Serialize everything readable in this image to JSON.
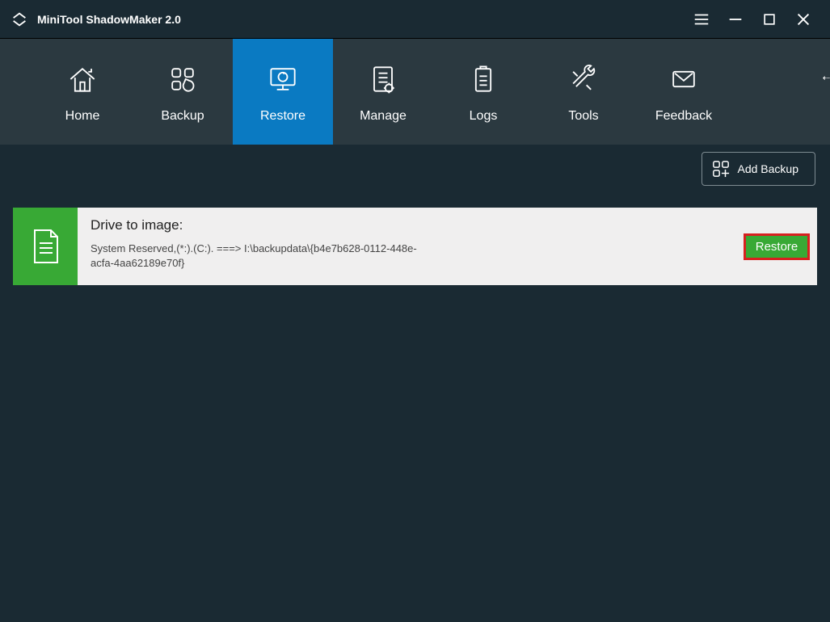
{
  "app": {
    "title": "MiniTool ShadowMaker 2.0"
  },
  "nav": {
    "home": "Home",
    "backup": "Backup",
    "restore": "Restore",
    "manage": "Manage",
    "logs": "Logs",
    "tools": "Tools",
    "feedback": "Feedback",
    "active": "restore"
  },
  "toolbar": {
    "add_backup": "Add Backup"
  },
  "backup_item": {
    "title": "Drive to image:",
    "detail": "System Reserved,(*:).(C:). ===> I:\\backupdata\\{b4e7b628-0112-448e-acfa-4aa62189e70f}",
    "action": "Restore"
  },
  "colors": {
    "accent_blue": "#0a7ac2",
    "accent_green": "#38a935",
    "highlight_red": "#d7201f",
    "bg_dark": "#1a2a33",
    "nav_bg": "#2b3940"
  }
}
